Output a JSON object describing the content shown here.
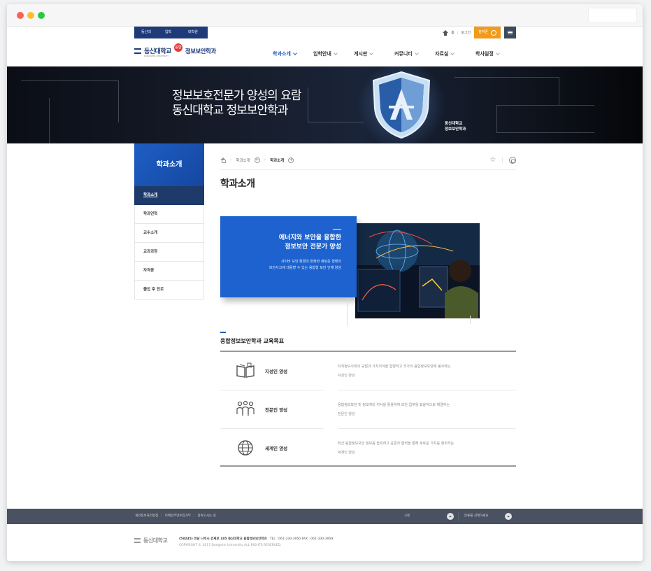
{
  "utility": {
    "links": [
      "동신대",
      "입학",
      "대학원"
    ],
    "home": "홈",
    "login": "로그인",
    "login_button": "참여존"
  },
  "header": {
    "univ_name": "동신대학교",
    "univ_sub": "DONGSHIN UNIVERSITY",
    "badge": "융합",
    "dept_name": "정보보안학과",
    "nav": [
      "학과소개",
      "입학안내",
      "게시판",
      "커뮤니티",
      "자료실",
      "학사일정"
    ]
  },
  "banner": {
    "line1": "정보보호전문가 양성의 요람",
    "line2": "동신대학교 정보보안학과",
    "caption1": "동신대학교",
    "caption2": "정보보안학과"
  },
  "lnb": {
    "title": "학과소개",
    "items": [
      "학과소개",
      "학과연혁",
      "교수소개",
      "교과과정",
      "자격증",
      "졸업 후 진로"
    ]
  },
  "breadcrumb": {
    "level1": "학과소개",
    "level2": "학과소개",
    "star": "☆"
  },
  "page": {
    "title": "학과소개"
  },
  "intro": {
    "heading1": "에너지와 보안을 융합한",
    "heading2": "정보보안 전문가 양성",
    "desc1": "사이버 보안 환경의 변화와 새로운 형태의",
    "desc2": "보안사고에 대응할 수 있는 융합형 보안 인재 양성"
  },
  "goals": {
    "title": "융합정보보안학과 교육목표",
    "items": [
      {
        "icon": "book-icon",
        "label": "지성인 양성",
        "desc1": "지식정보사회의 규범과 가치의식을 함양하고 국가의 융합정보보안에 봉사하는",
        "desc2": "지성인 양성"
      },
      {
        "icon": "people-icon",
        "label": "전문인 양성",
        "desc1": "융합정보보안 및 정보처리 지식을 활용하여 보안 업무를 효율적으로 해결하는",
        "desc2": "전문인 양성"
      },
      {
        "icon": "globe-icon",
        "label": "세계인 양성",
        "desc1": "최신 융합정보보안 정보를 습득하고 공존과 협력을 통해 새로운 가치를 창조하는",
        "desc2": "세계인 양성"
      }
    ]
  },
  "footer": {
    "links": [
      "개인정보처리방침",
      "이메일무단수집거부",
      "찾아오시는 길"
    ],
    "select1": "구분",
    "select2": "분류를 선택하세요",
    "logo": "동신대학교",
    "address": "(58245) 전남 나주시 건재로 185 동신대학교 융합정보보안학과",
    "tel": "TEL : 061-330-3950   FAX : 061-330-3959",
    "copyright": "COPYRIGHT © 2017 Dongshin University ALL RIGHTS RESERVED."
  },
  "colors": {
    "primary": "#1d62cf",
    "navy": "#1e3a78",
    "accent_orange": "#f39a1a",
    "footer_bar": "#4a5160"
  }
}
